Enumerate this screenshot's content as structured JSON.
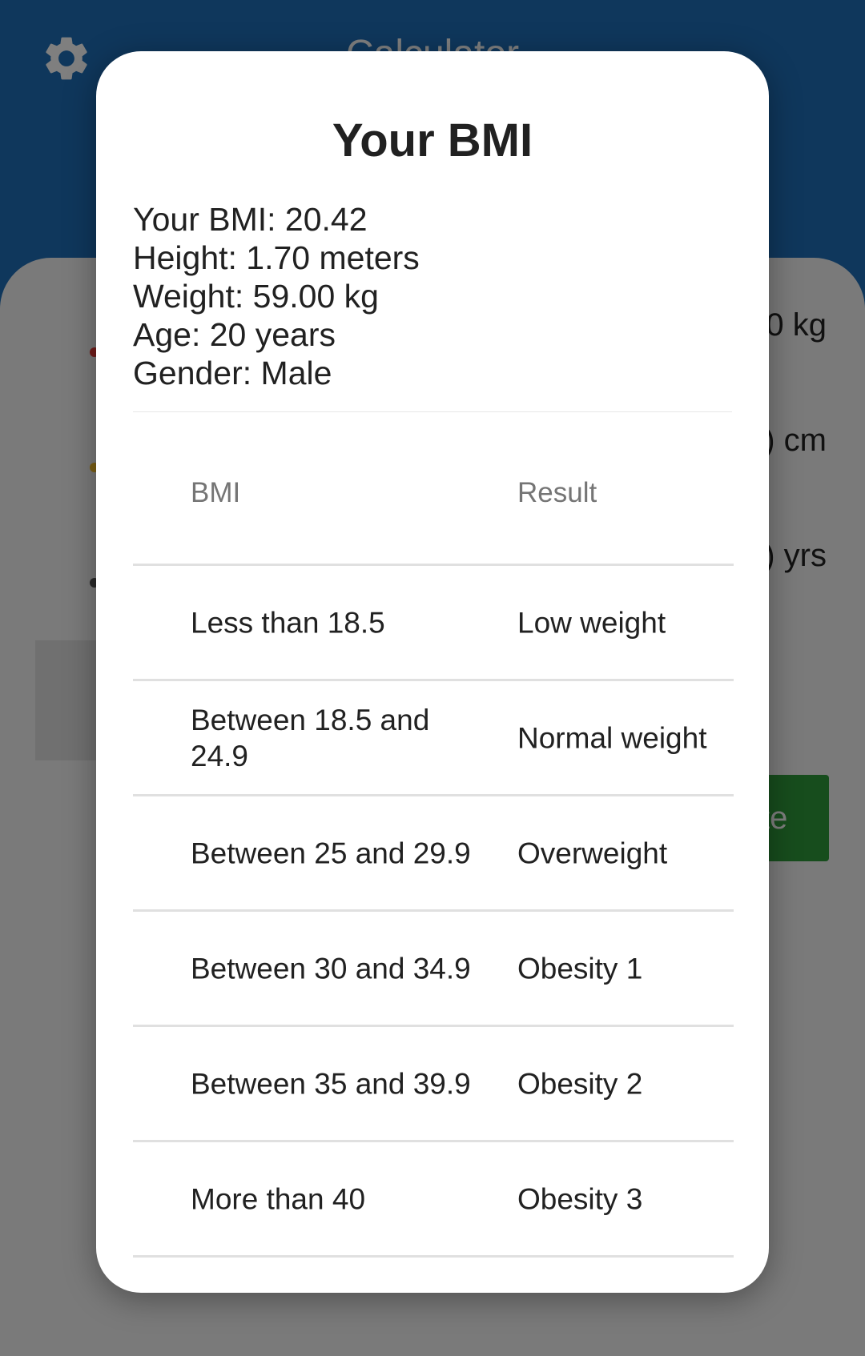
{
  "app": {
    "title": "Calculator"
  },
  "background": {
    "weight_suffix": "0 kg",
    "height_suffix": ") cm",
    "age_suffix": ") yrs",
    "calculate_partial": "te"
  },
  "dialog": {
    "title": "Your BMI",
    "summary": {
      "bmi": "Your BMI: 20.42",
      "height": "Height: 1.70 meters",
      "weight": "Weight: 59.00 kg",
      "age": "Age: 20 years",
      "gender": "Gender: Male"
    },
    "table": {
      "headers": [
        "BMI",
        "Result"
      ],
      "rows": [
        {
          "bmi": "Less than 18.5",
          "result": "Low weight"
        },
        {
          "bmi": "Between 18.5 and 24.9",
          "result": "Normal weight"
        },
        {
          "bmi": "Between 25 and 29.9",
          "result": "Overweight"
        },
        {
          "bmi": "Between 30 and 34.9",
          "result": "Obesity 1"
        },
        {
          "bmi": "Between 35 and 39.9",
          "result": "Obesity 2"
        },
        {
          "bmi": "More than 40",
          "result": "Obesity 3"
        }
      ]
    }
  },
  "colors": {
    "header_blue": "#1f6fb8",
    "calculate_green": "#2e9a3a"
  },
  "icons": {
    "settings": "gear-icon"
  }
}
